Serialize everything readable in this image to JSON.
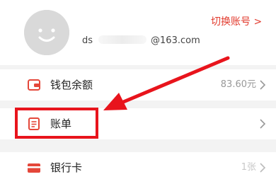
{
  "profile": {
    "email_prefix": "ds",
    "email_suffix": "@163.com",
    "switch_account_label": "切换账号"
  },
  "rows": [
    {
      "label": "钱包余额",
      "value": "83.60元",
      "icon": "wallet-icon"
    },
    {
      "label": "账单",
      "value": "",
      "icon": "bill-icon"
    },
    {
      "label": "银行卡",
      "value": "1张",
      "icon": "bank-card-icon"
    }
  ],
  "colors": {
    "accent": "#e23b2e",
    "annotation_red": "#e8141c",
    "icon_red": "#e4473a",
    "page_background": "#f3f3f3"
  }
}
